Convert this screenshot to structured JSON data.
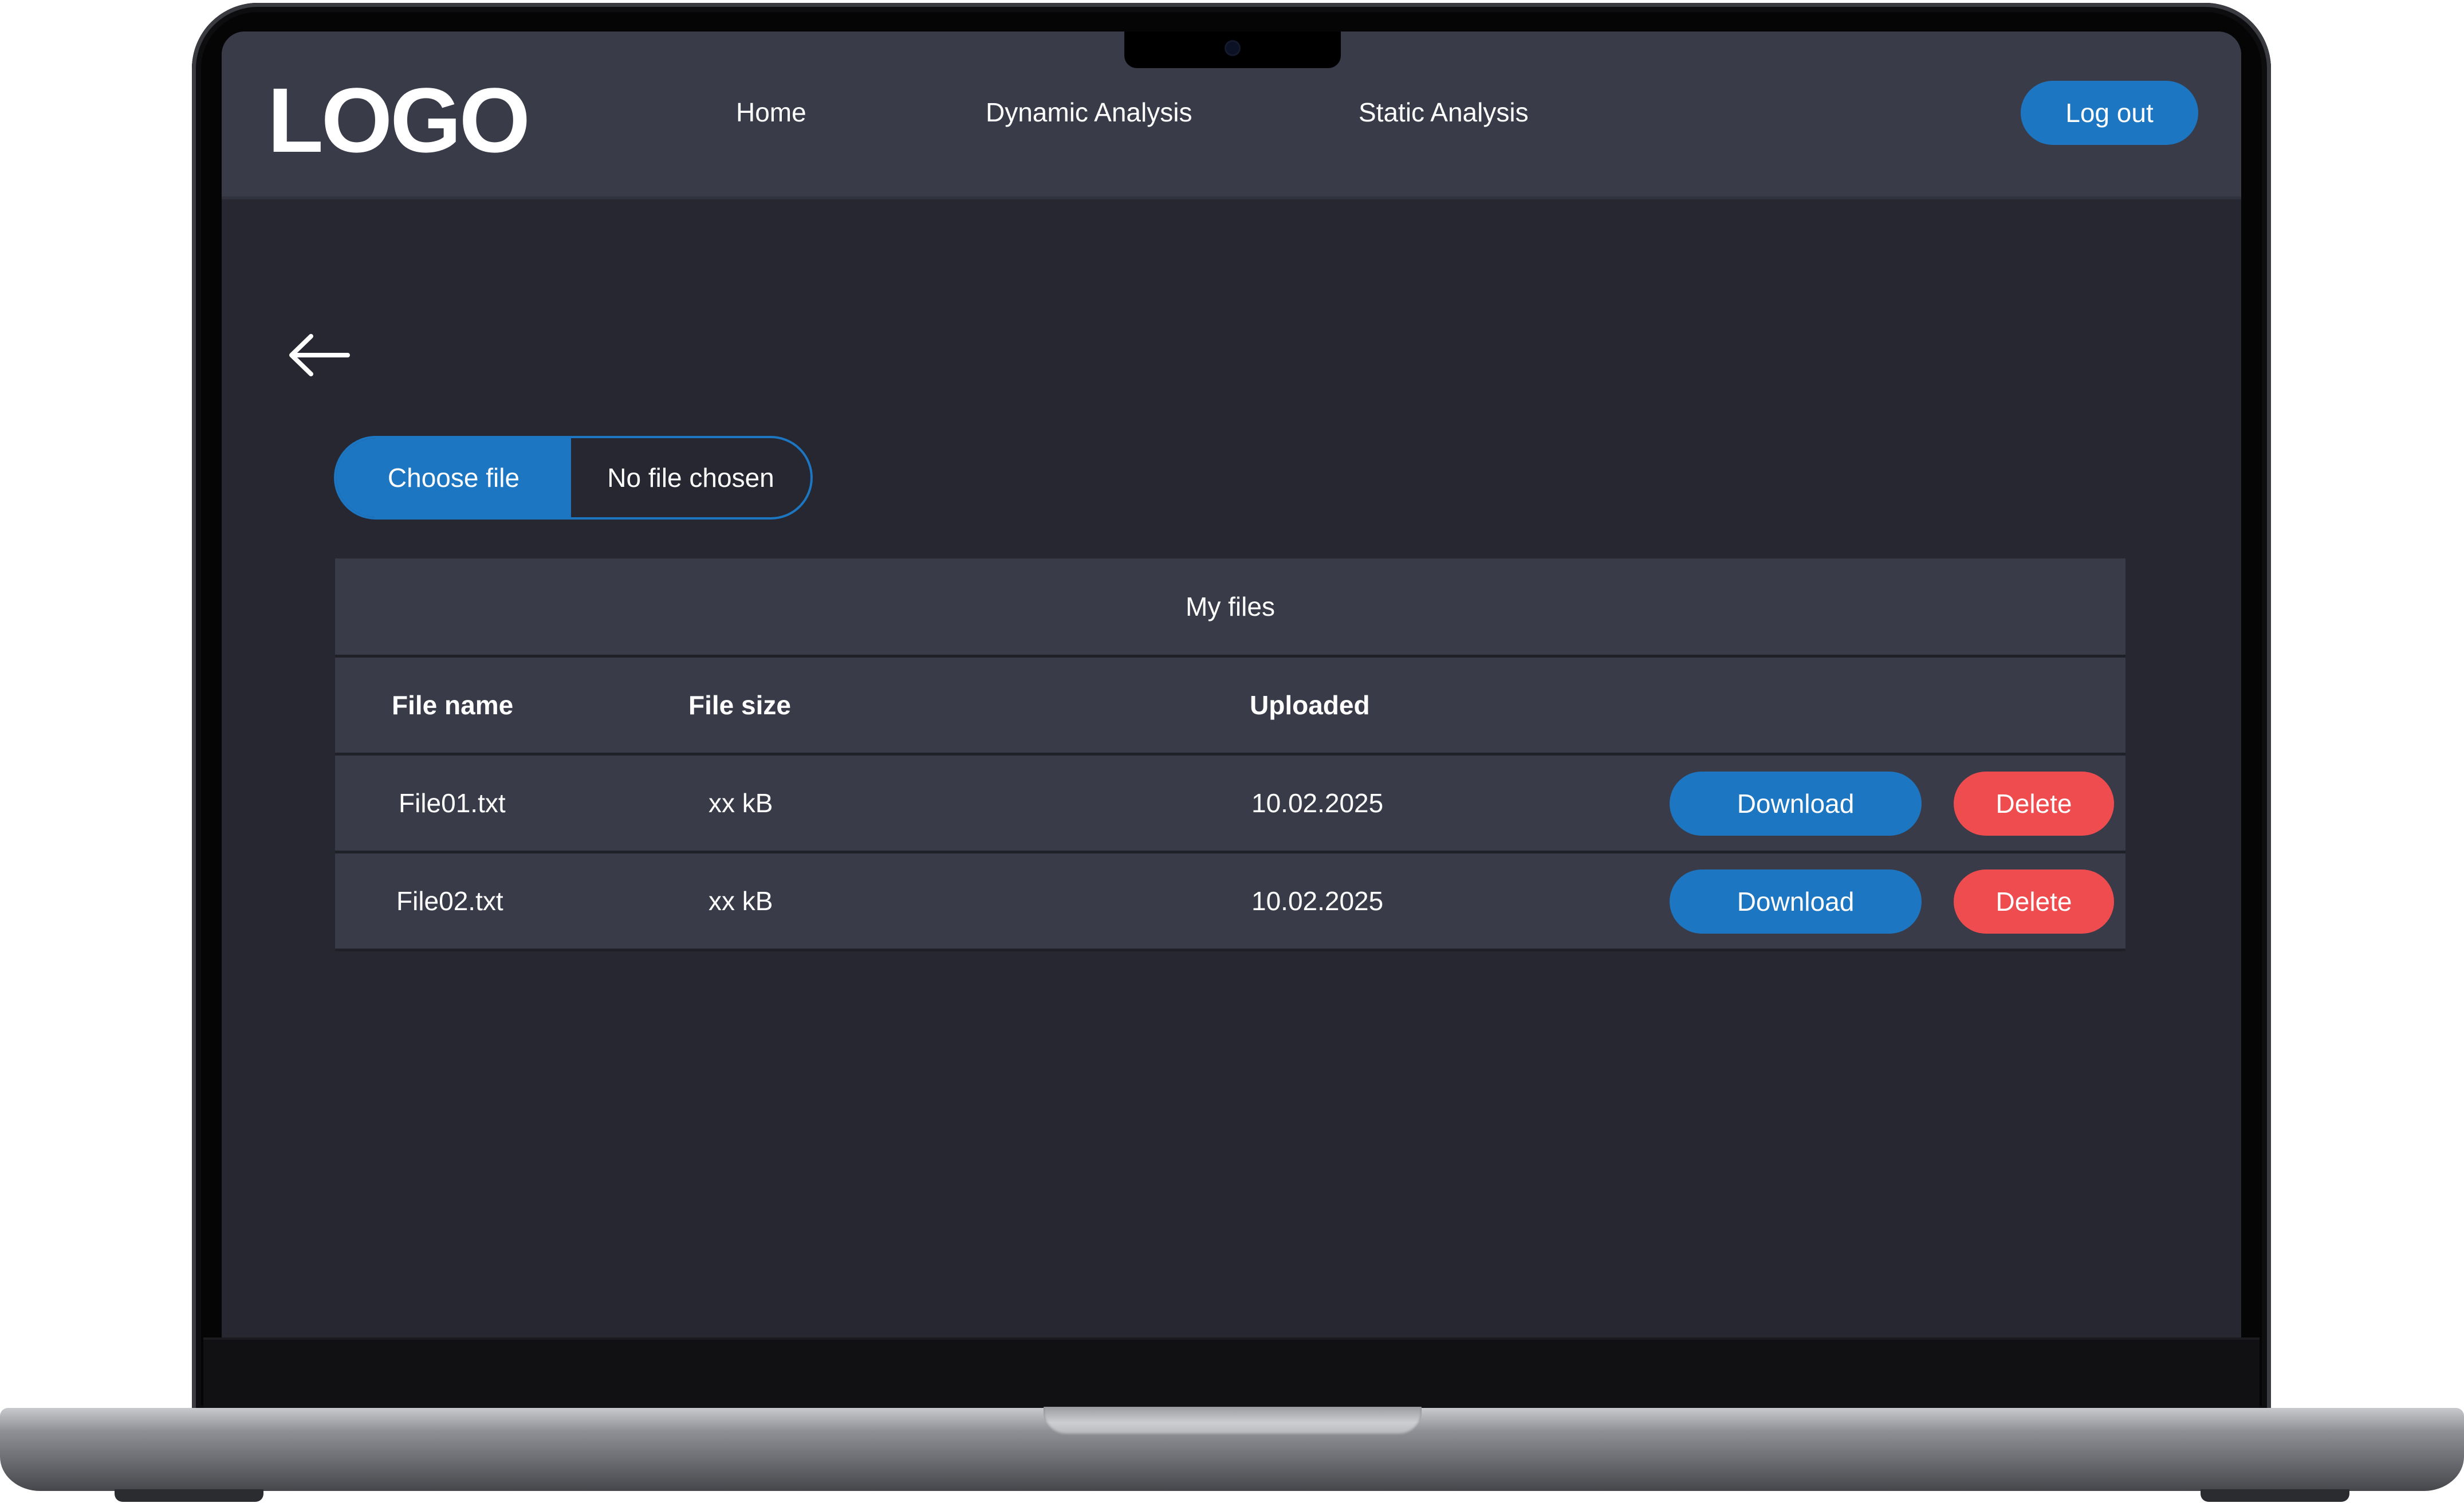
{
  "header": {
    "logo": "LOGO",
    "nav": [
      "Home",
      "Dynamic Analysis",
      "Static Analysis"
    ],
    "logout_label": "Log out"
  },
  "upload": {
    "choose_label": "Choose file",
    "status": "No file chosen"
  },
  "files_table": {
    "title": "My files",
    "columns": [
      "File name",
      "File size",
      "Uploaded"
    ],
    "rows": [
      {
        "name": "File01.txt",
        "size": "xx kB",
        "uploaded": "10.02.2025",
        "download_label": "Download",
        "delete_label": "Delete"
      },
      {
        "name": "File02.txt",
        "size": "xx kB",
        "uploaded": "10.02.2025",
        "download_label": "Download",
        "delete_label": "Delete"
      }
    ]
  },
  "icons": {
    "back": "arrow-left-icon",
    "camera": "camera-icon"
  },
  "colors": {
    "accent": "#1d76c2",
    "danger": "#ee4c4f",
    "topbar_bg": "#393b48",
    "page_bg": "#262730",
    "text": "#ffffff"
  }
}
